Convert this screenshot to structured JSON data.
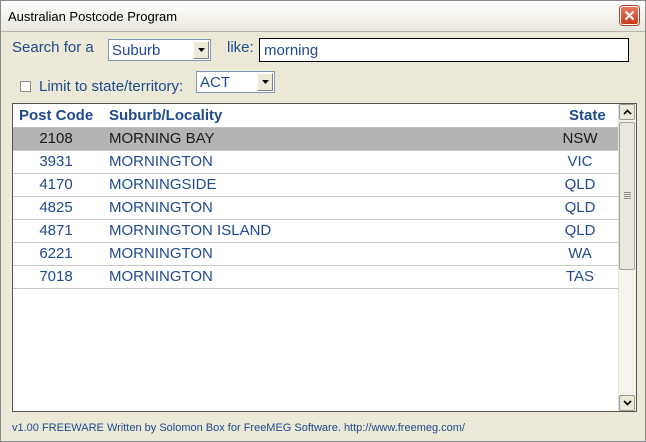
{
  "window": {
    "title": "Australian Postcode Program"
  },
  "search": {
    "label": "Search for a",
    "field_select": "Suburb",
    "like_label": "like:",
    "query": "morning"
  },
  "filter": {
    "label": "Limit to state/territory:",
    "checked": false,
    "state_select": "ACT"
  },
  "table": {
    "headers": {
      "code": "Post Code",
      "suburb": "Suburb/Locality",
      "state": "State"
    },
    "rows": [
      {
        "code": "2108",
        "suburb": "MORNING BAY",
        "state": "NSW"
      },
      {
        "code": "3931",
        "suburb": "MORNINGTON",
        "state": "VIC"
      },
      {
        "code": "4170",
        "suburb": "MORNINGSIDE",
        "state": "QLD"
      },
      {
        "code": "4825",
        "suburb": "MORNINGTON",
        "state": "QLD"
      },
      {
        "code": "4871",
        "suburb": "MORNINGTON ISLAND",
        "state": "QLD"
      },
      {
        "code": "6221",
        "suburb": "MORNINGTON",
        "state": "WA"
      },
      {
        "code": "7018",
        "suburb": "MORNINGTON",
        "state": "TAS"
      }
    ]
  },
  "footer": {
    "text": "v1.00 FREEWARE Written by Solomon Box for FreeMEG Software. http://www.freemeg.com/"
  },
  "colors": {
    "label_blue": "#1f4a8c",
    "selected_row": "#b4b4b4",
    "close_red": "#c63c1c"
  },
  "icons": {
    "close": "close-icon",
    "dropdown": "chevron-down-icon",
    "scroll_up": "arrow-up-icon",
    "scroll_down": "arrow-down-icon"
  }
}
